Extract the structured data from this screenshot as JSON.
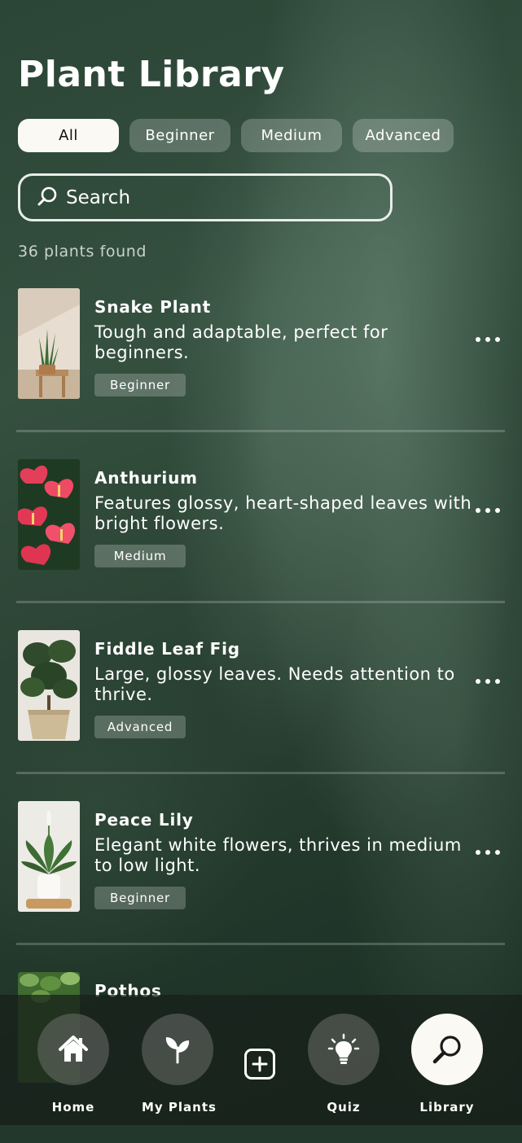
{
  "header": {
    "title": "Plant Library"
  },
  "filters": [
    {
      "label": "All",
      "active": true
    },
    {
      "label": "Beginner",
      "active": false
    },
    {
      "label": "Medium",
      "active": false
    },
    {
      "label": "Advanced",
      "active": false
    }
  ],
  "search": {
    "placeholder": "Search",
    "icon": "search-icon"
  },
  "results": {
    "count_text": "36 plants found"
  },
  "plants": [
    {
      "name": "Snake Plant",
      "description": "Tough and adaptable, perfect for beginners.",
      "level": "Beginner"
    },
    {
      "name": "Anthurium",
      "description": "Features glossy, heart-shaped leaves with bright flowers.",
      "level": "Medium"
    },
    {
      "name": "Fiddle Leaf Fig",
      "description": "Large, glossy leaves. Needs attention to thrive.",
      "level": "Advanced"
    },
    {
      "name": "Peace Lily",
      "description": "Elegant white flowers, thrives in medium to low light.",
      "level": "Beginner"
    },
    {
      "name": "Pothos"
    }
  ],
  "tabbar": {
    "tabs": [
      {
        "label": "Home",
        "icon": "home-icon",
        "active": false
      },
      {
        "label": "My Plants",
        "icon": "sprout-icon",
        "active": false
      },
      {
        "label": "Quiz",
        "icon": "lightbulb-icon",
        "active": false
      },
      {
        "label": "Library",
        "icon": "search-icon",
        "active": true
      }
    ],
    "add_icon": "plus-square-icon"
  },
  "colors": {
    "active_chip": "#fbf9f4",
    "background": "#2b4536"
  }
}
